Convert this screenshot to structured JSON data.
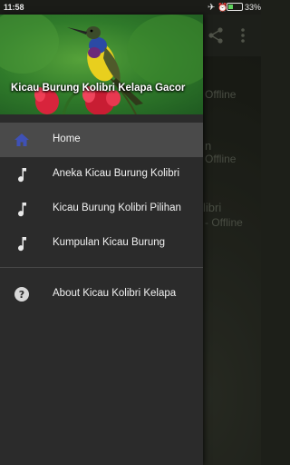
{
  "status_bar": {
    "time": "11:58",
    "battery_percent": 33,
    "battery_label": "33%",
    "icons": [
      "airplane-icon",
      "alarm-icon",
      "battery-icon"
    ]
  },
  "background": {
    "toolbar_icons": [
      "share-icon",
      "more-icon"
    ],
    "visible_text": [
      "Offline",
      "n",
      "Offline",
      "libri",
      "- Offline"
    ]
  },
  "drawer": {
    "header_title": "Kicau Burung Kolibri Kelapa Gacor",
    "items": [
      {
        "label": "Home",
        "icon": "home-icon",
        "active": true
      },
      {
        "label": "Aneka Kicau Burung Kolibri",
        "icon": "music-note-icon",
        "active": false
      },
      {
        "label": "Kicau Burung Kolibri Pilihan",
        "icon": "music-note-icon",
        "active": false
      },
      {
        "label": "Kumpulan Kicau Burung",
        "icon": "music-note-icon",
        "active": false
      }
    ],
    "about": {
      "label": "About Kicau Kolibri Kelapa",
      "icon": "help-icon"
    }
  },
  "colors": {
    "accent_home_icon": "#3f51b5",
    "drawer_bg": "#2b2b2b",
    "active_item_bg": "#4a4a4a"
  }
}
